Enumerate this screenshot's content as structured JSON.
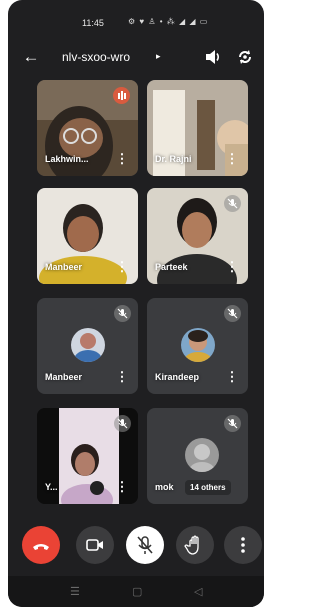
{
  "status_bar": {
    "time": "11:45",
    "icons_text": "⚙ ♥ ♙ • ⁂ ◢ ◢ ▭"
  },
  "header": {
    "meeting_code": "nlv-sxoo-wro",
    "chevron": "▸"
  },
  "participants": [
    {
      "name": "Lakhwin...",
      "tile": "video",
      "audio": "speaking"
    },
    {
      "name": "Dr. Rajni",
      "tile": "video",
      "audio": "unmuted"
    },
    {
      "name": "Manbeer",
      "tile": "video",
      "audio": "unmuted"
    },
    {
      "name": "Parteek",
      "tile": "video",
      "audio": "muted"
    },
    {
      "name": "Manbeer",
      "tile": "avatar",
      "audio": "muted"
    },
    {
      "name": "Kirandeep",
      "tile": "avatar",
      "audio": "muted"
    },
    {
      "name": "Y...",
      "tile": "video",
      "audio": "muted"
    },
    {
      "name": "mok",
      "tile": "avatar",
      "audio": "muted"
    }
  ],
  "others_badge": "14 others",
  "controls": [
    "end-call",
    "camera",
    "microphone-muted",
    "raise-hand",
    "more-options"
  ],
  "colors": {
    "background": "#1f1f21",
    "tile": "#3b3c3f",
    "end_call": "#ea4335",
    "mic_button": "#ffffff",
    "control": "#3c3c3e"
  }
}
